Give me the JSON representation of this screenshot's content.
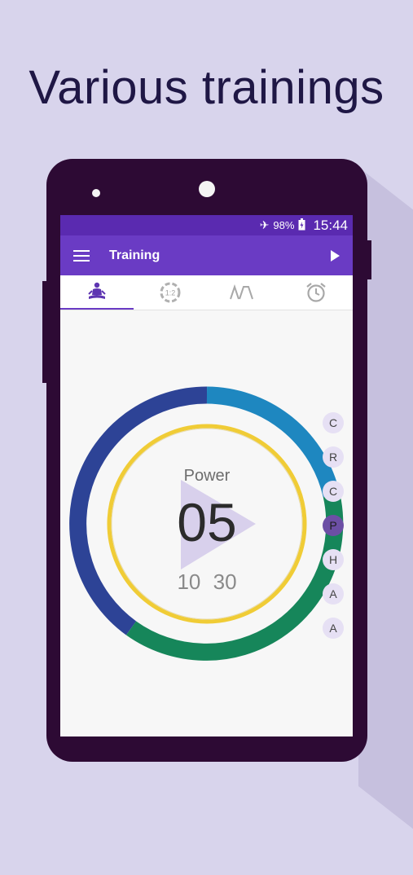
{
  "headline": "Various trainings",
  "status_bar": {
    "battery": "98%",
    "time": "15:44"
  },
  "app_bar": {
    "title": "Training"
  },
  "tabs": [
    {
      "icon": "meditation-icon",
      "active": true
    },
    {
      "icon": "ratio-timer-icon",
      "label": "1:2",
      "active": false
    },
    {
      "icon": "wave-pattern-icon",
      "active": false
    },
    {
      "icon": "alarm-clock-icon",
      "active": false
    }
  ],
  "timer": {
    "phase": "Power",
    "count": "05",
    "sub_a": "10",
    "sub_b": "30"
  },
  "side_letters": [
    "C",
    "R",
    "C",
    "P",
    "H",
    "A",
    "A"
  ],
  "active_letter_index": 3,
  "colors": {
    "status_bar": "#5a2ab0",
    "app_bar": "#6a3bc4",
    "ring_navy": "#2d4396",
    "ring_blue": "#1e87c0",
    "ring_green": "#16865a",
    "ring_yellow": "#f0cc36"
  }
}
